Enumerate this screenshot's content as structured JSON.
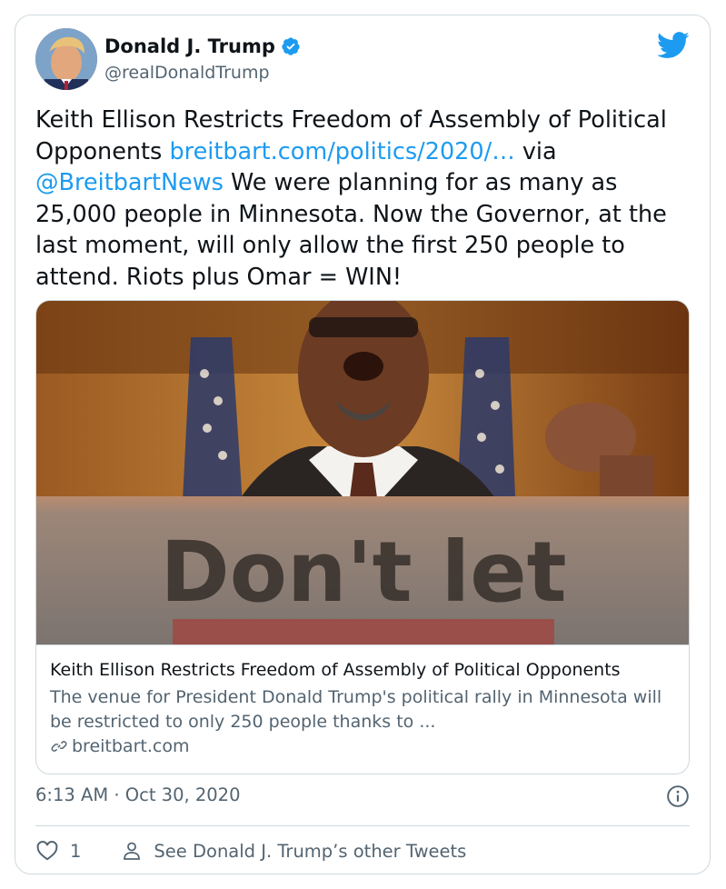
{
  "author": {
    "name": "Donald J. Trump",
    "handle": "@realDonaldTrump"
  },
  "tweet": {
    "text_part1": "Keith Ellison Restricts Freedom of Assembly of Political Opponents ",
    "link": "breitbart.com/politics/2020/…",
    "text_part2": " via ",
    "mention": "@BreitbartNews",
    "text_part3": " We were planning for as many as 25,000 people in Minnesota. Now the Governor, at the last moment, will only allow the first 250 people to attend. Riots plus Omar = WIN!"
  },
  "link_card": {
    "image_sign_text": "Don't let",
    "title": "Keith Ellison Restricts Freedom of Assembly of Political Opponents",
    "description": "The venue for President Donald Trump's political rally in Minnesota will be restricted to only 250 people thanks to ...",
    "domain": "breitbart.com"
  },
  "meta": {
    "time": "6:13 AM · Oct 30, 2020"
  },
  "actions": {
    "like_count": "1",
    "other_tweets": "See Donald J. Trump’s other Tweets"
  },
  "colors": {
    "link": "#1d9bf0",
    "text": "#0f1419",
    "secondary": "#536471",
    "border": "#cfd9de"
  },
  "icons": [
    "verified-badge-icon",
    "twitter-bird-icon",
    "link-icon",
    "info-icon",
    "heart-icon",
    "person-icon"
  ]
}
